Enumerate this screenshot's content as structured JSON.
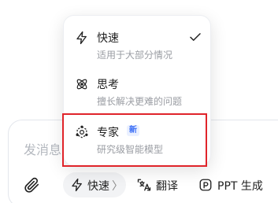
{
  "input": {
    "placeholder": "发消息"
  },
  "toolbar": {
    "attach_icon": "paperclip-icon",
    "mode_label": "快速",
    "mode_chevron": "〉",
    "translate_label": "翻译",
    "ppt_label": "PPT 生成"
  },
  "menu": {
    "items": [
      {
        "title": "快速",
        "desc": "适用于大部分情况",
        "icon": "lightning-icon",
        "selected": true
      },
      {
        "title": "思考",
        "desc": "擅长解决更难的问题",
        "icon": "atom-icon",
        "selected": false
      },
      {
        "title": "专家",
        "desc": "研究级智能模型",
        "icon": "expert-icon",
        "badge": "新",
        "selected": false
      }
    ]
  },
  "colors": {
    "accent": "#3b6ef6",
    "highlight": "#e0242a",
    "pill_bg": "#f2f3f5"
  }
}
